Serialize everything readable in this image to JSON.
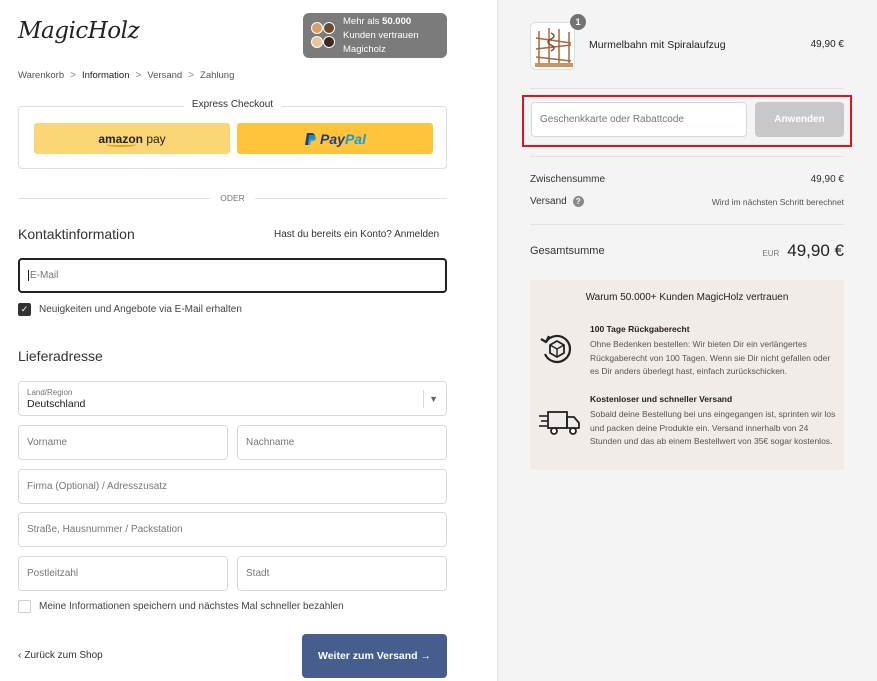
{
  "header": {
    "logo_text": "MagicHolz",
    "trust_badge": {
      "text_prefix": "Mehr als ",
      "count": "50.000",
      "text_suffix": " Kunden vertrauen Magicholz"
    }
  },
  "breadcrumb": {
    "items": [
      "Warenkorb",
      "Information",
      "Versand",
      "Zahlung"
    ],
    "separator": ">"
  },
  "express_checkout": {
    "title": "Express Checkout",
    "amazon_label_a": "amazon",
    "amazon_label_b": " pay",
    "paypal_label_a": "Pay",
    "paypal_label_b": "Pal",
    "divider": "ODER"
  },
  "contact": {
    "title": "Kontaktinformation",
    "account_hint": "Hast du bereits ein Konto?",
    "login_link": "Anmelden",
    "email_placeholder": "E-Mail",
    "newsletter_label": "Neuigkeiten und Angebote via E-Mail erhalten",
    "newsletter_checked": true
  },
  "shipping": {
    "title": "Lieferadresse",
    "country_label": "Land/Region",
    "country_value": "Deutschland",
    "first_name_placeholder": "Vorname",
    "last_name_placeholder": "Nachname",
    "company_placeholder": "Firma (Optional) / Adresszusatz",
    "street_placeholder": "Straße, Hausnummer / Packstation",
    "zip_placeholder": "Postleitzahl",
    "city_placeholder": "Stadt",
    "save_info_label": "Meine Informationen speichern und nächstes Mal schneller bezahlen",
    "save_info_checked": false
  },
  "footer": {
    "back_label": "Zurück zum Shop",
    "continue_label": "Weiter zum Versand →"
  },
  "order": {
    "product": {
      "name": "Murmelbahn mit Spiralaufzug",
      "price": "49,90 €",
      "quantity": "1"
    },
    "discount": {
      "placeholder": "Geschenkkarte oder Rabattcode",
      "apply_label": "Anwenden"
    },
    "subtotal_label": "Zwischensumme",
    "subtotal_value": "49,90 €",
    "shipping_label": "Versand",
    "shipping_value": "Wird im nächsten Schritt berechnet",
    "total_label": "Gesamtsumme",
    "total_currency": "EUR",
    "total_value": "49,90 €"
  },
  "trust_box": {
    "title": "Warum 50.000+ Kunden MagicHolz vertrauen",
    "benefits": [
      {
        "title": "100 Tage Rückgaberecht",
        "text": "Ohne Bedenken bestellen: Wir bieten Dir ein verlängertes Rückgaberecht von 100 Tagen. Wenn sie Dir nicht gefallen oder es Dir anders überlegt hast, einfach zurückschicken.",
        "icon": "return-icon"
      },
      {
        "title": "Kostenloser und schneller Versand",
        "text": "Sobald deine Bestellung bei uns eingegangen ist, sprinten wir los und packen deine Produkte ein. Versand innerhalb von 24 Stunden und das ab einem Bestellwert von 35€ sogar kostenlos.",
        "icon": "truck-icon"
      }
    ]
  },
  "colors": {
    "primary_button": "#465e8e",
    "highlight_border": "#e1141e",
    "amazon_yellow": "#fad676",
    "paypal_yellow": "#ffc43a"
  }
}
